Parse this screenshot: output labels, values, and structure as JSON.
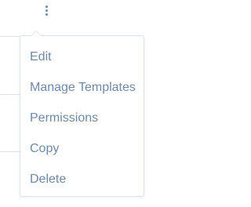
{
  "trigger": {
    "icon": "vertical-ellipsis-icon"
  },
  "menu": {
    "items": [
      {
        "label": "Edit"
      },
      {
        "label": "Manage Templates"
      },
      {
        "label": "Permissions"
      },
      {
        "label": "Copy"
      },
      {
        "label": "Delete"
      }
    ]
  },
  "colors": {
    "item_text": "#7089a7",
    "icon": "#6f8aa6",
    "menu_border": "#dde2e7",
    "background": "#ffffff"
  }
}
